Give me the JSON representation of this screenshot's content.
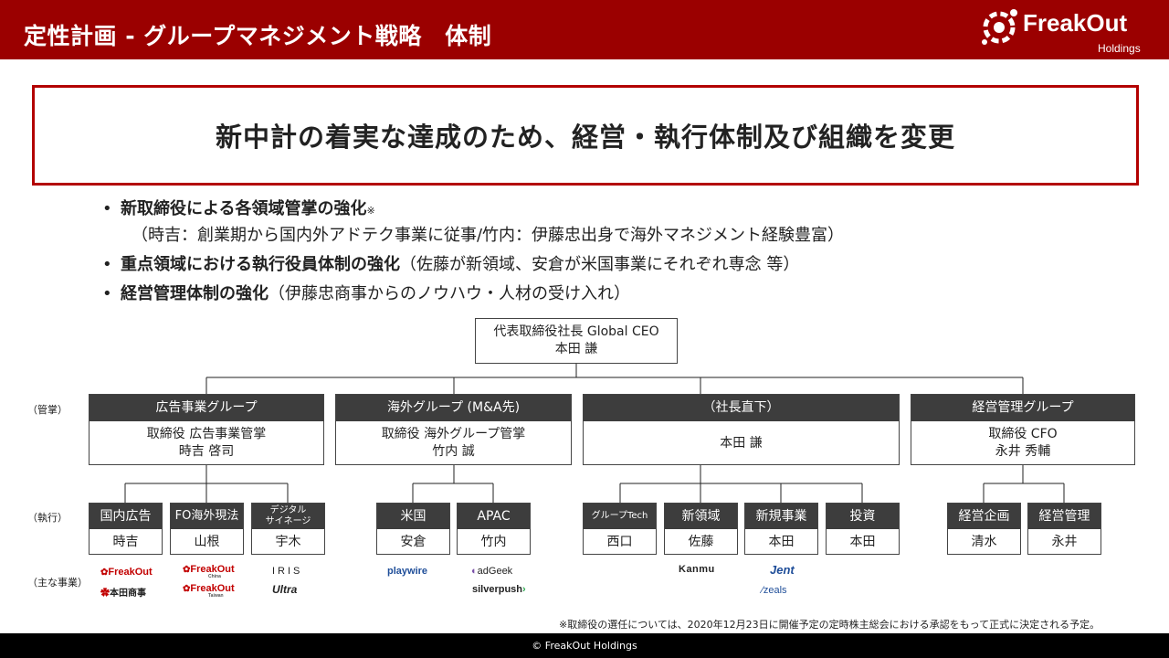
{
  "header": {
    "title": "定性計画 - グループマネジメント戦略　体制"
  },
  "logo": {
    "brand": "FreakOut",
    "sub": "Holdings"
  },
  "headline": "新中計の着実な達成のため、経営・執行体制及び組織を変更",
  "bullets": [
    {
      "bold": "新取締役による各領域管掌の強化",
      "note": "※",
      "detail": "（時吉：創業期から国内外アドテク事業に従事/竹内：伊藤忠出身で海外マネジメント経験豊富）"
    },
    {
      "bold": "重点領域における執行役員体制の強化",
      "detail": "（佐藤が新領域、安倉が米国事業にそれぞれ専念 等）"
    },
    {
      "bold": "経営管理体制の強化",
      "detail": "（伊藤忠商事からのノウハウ・人材の受け入れ）"
    }
  ],
  "ceo": {
    "role": "代表取締役社長 Global CEO",
    "name": "本田 謙"
  },
  "row_labels": {
    "kansho": "（管掌）",
    "shikko": "（執行）",
    "business": "（主な事業）"
  },
  "groups": [
    {
      "head": "広告事業グループ",
      "line1": "取締役 広告事業管掌",
      "line2": "時吉 啓司"
    },
    {
      "head": "海外グループ (M&A先)",
      "line1": "取締役 海外グループ管掌",
      "line2": "竹内 誠"
    },
    {
      "head": "（社長直下）",
      "line1": "本田 謙",
      "line2": ""
    },
    {
      "head": "経営管理グループ",
      "line1": "取締役 CFO",
      "line2": "永井 秀輔"
    }
  ],
  "units": [
    {
      "head": "国内広告",
      "name": "時吉"
    },
    {
      "head": "FO海外現法",
      "name": "山根"
    },
    {
      "head": "デジタル\nサイネージ",
      "name": "宇木"
    },
    {
      "head": "米国",
      "name": "安倉"
    },
    {
      "head": "APAC",
      "name": "竹内"
    },
    {
      "head": "グループTech",
      "name": "西口"
    },
    {
      "head": "新領域",
      "name": "佐藤"
    },
    {
      "head": "新規事業",
      "name": "本田"
    },
    {
      "head": "投資",
      "name": "本田"
    },
    {
      "head": "経営企画",
      "name": "清水"
    },
    {
      "head": "経営管理",
      "name": "永井"
    }
  ],
  "business_logos": {
    "freakout": "FreakOut",
    "honda_shoji": "本田商事",
    "freakout_china": "FreakOut",
    "china": "China",
    "freakout_taiwan": "FreakOut",
    "taiwan": "Taiwan",
    "iris": "IRIS",
    "ultra": "Ultra",
    "playwire": "playwire",
    "adgeek": "adGeek",
    "silverpush": "silverpush",
    "kanmu": "Kanmu",
    "jent": "Jent",
    "zeals": "zeals"
  },
  "footnote": "※取締役の選任については、2020年12月23日に開催予定の定時株主総会における承認をもって正式に決定される予定。",
  "footer": "© FreakOut Holdings",
  "colors": {
    "header": "#9b0000",
    "headline_border": "#b30000",
    "box_head": "#3d3d3d",
    "footer": "#000000"
  }
}
